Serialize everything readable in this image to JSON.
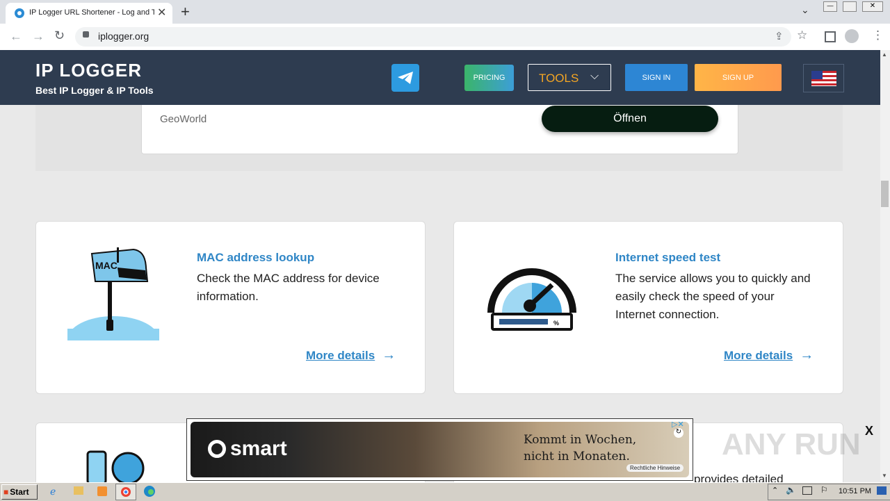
{
  "browser": {
    "tab_title": "IP Logger URL Shortener - Log and Tr",
    "new_tab": "+",
    "url": "iplogger.org"
  },
  "site": {
    "logo_main": "IP LOGGER",
    "logo_sub": "Best IP Logger & IP Tools",
    "nav": {
      "pricing": "PRICING",
      "tools": "TOOLS",
      "sign_in": "SIGN IN",
      "sign_up": "SIGN UP"
    }
  },
  "top_card": {
    "label": "GeoWorld",
    "button": "Öffnen"
  },
  "cards": [
    {
      "title": "MAC address lookup",
      "desc": "Check the MAC address for device information.",
      "more": "More details",
      "icon_text": "MAC"
    },
    {
      "title": "Internet speed test",
      "desc": "The service allows you to quickly and easily check the speed of your Internet connection.",
      "more": "More details"
    }
  ],
  "partial_text": "provides detailed",
  "ad": {
    "brand": "smart",
    "line1": "Kommt in Wochen,",
    "line2": "nicht in Monaten.",
    "legal": "Rechtliche Hinweise",
    "close": "X"
  },
  "watermark": "ANY RUN",
  "taskbar": {
    "start": "Start",
    "time": "10:51 PM"
  }
}
